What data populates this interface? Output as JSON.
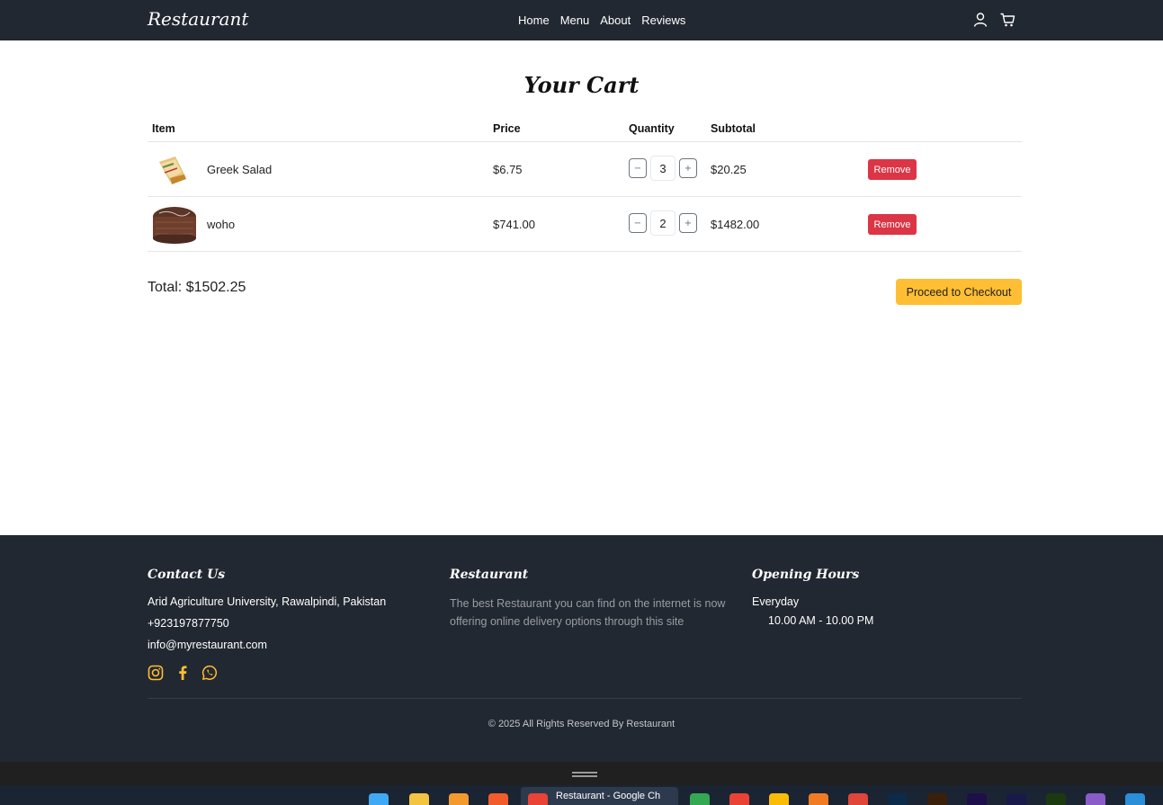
{
  "navbar": {
    "brand": "Restaurant",
    "links": [
      "Home",
      "Menu",
      "About",
      "Reviews"
    ],
    "icons": [
      "user-icon",
      "cart-icon"
    ]
  },
  "cart": {
    "title": "Your Cart",
    "columns": [
      "Item",
      "Price",
      "Quantity",
      "Subtotal"
    ],
    "items": [
      {
        "name": "Greek Salad",
        "price": "$6.75",
        "quantity": "3",
        "subtotal": "$20.25",
        "remove_label": "Remove",
        "decrement": "−",
        "increment": "+"
      },
      {
        "name": "woho",
        "price": "$741.00",
        "quantity": "2",
        "subtotal": "$1482.00",
        "remove_label": "Remove",
        "decrement": "−",
        "increment": "+"
      }
    ],
    "total": "Total: $1502.25",
    "checkout_label": "Proceed to Checkout"
  },
  "footer": {
    "contact": {
      "heading": "Contact Us",
      "address": "Arid Agriculture University, Rawalpindi, Pakistan",
      "phone": "+923197877750",
      "email": "info@myrestaurant.com",
      "social_icons": [
        "instagram-icon",
        "facebook-icon",
        "whatsapp-icon"
      ]
    },
    "about": {
      "heading": "Restaurant",
      "description": "The best Restaurant you can find on the internet is now offering online delivery options through this site"
    },
    "hours": {
      "heading": "Opening Hours",
      "days": "Everyday",
      "time": "10.00 AM - 10.00 PM"
    },
    "copyright": "© 2025 All Rights Reserved By Restaurant"
  },
  "taskbar": {
    "active_window": "Restaurant - Google Ch"
  },
  "colors": {
    "dark": "#222831",
    "accent": "#ffbe33",
    "danger": "#dc3545"
  }
}
